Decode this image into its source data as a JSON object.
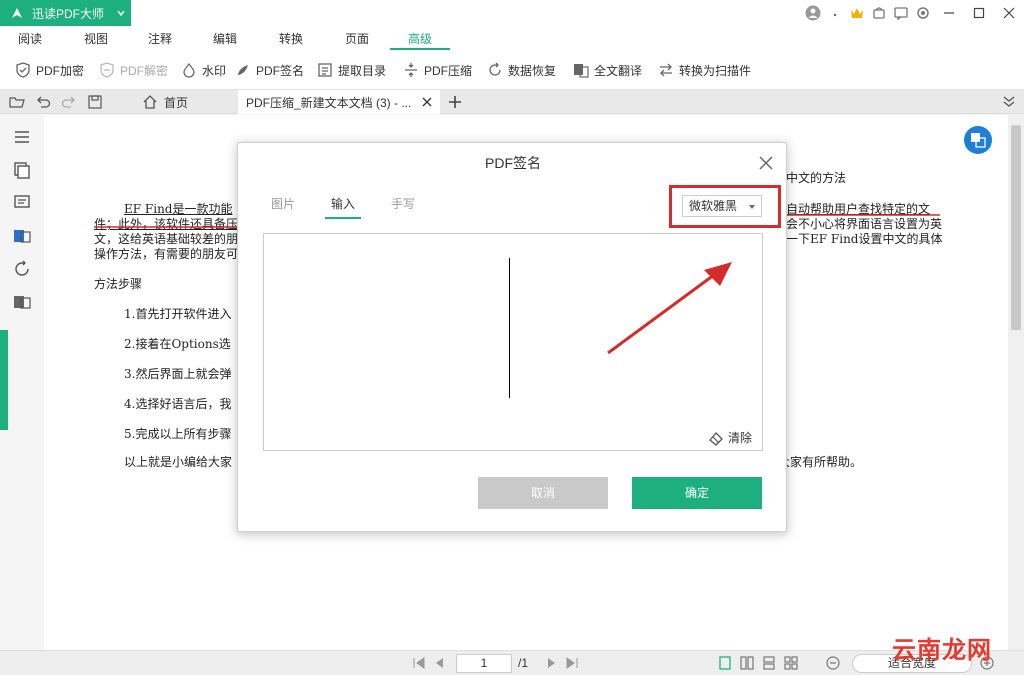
{
  "app": {
    "title": "迅读PDF大师"
  },
  "menu": {
    "tabs": [
      "阅读",
      "视图",
      "注释",
      "编辑",
      "转换",
      "页面",
      "高级"
    ],
    "active": "高级"
  },
  "ribbon": {
    "items": [
      {
        "label": "PDF加密",
        "icon": "shield-icon"
      },
      {
        "label": "PDF解密",
        "icon": "shield-off-icon",
        "disabled": true
      },
      {
        "label": "水印",
        "icon": "drop-icon"
      },
      {
        "label": "PDF签名",
        "icon": "pen-icon"
      },
      {
        "label": "提取目录",
        "icon": "extract-icon"
      },
      {
        "label": "PDF压缩",
        "icon": "compress-icon"
      },
      {
        "label": "数据恢复",
        "icon": "recover-icon"
      },
      {
        "label": "全文翻译",
        "icon": "translate-icon"
      },
      {
        "label": "转换为扫描件",
        "icon": "convert-icon"
      }
    ]
  },
  "tabs": {
    "home": "首页",
    "doc": "PDF压缩_新建文本文档 (3) - ..."
  },
  "document": {
    "lines": [
      "中文的方法",
      "EF Find是一款功能",
      "自动帮助用户查找特定的文",
      "件；此外，该软件还具备压",
      "会不小心将界面语言设置为英",
      "文，这给英语基础较差的朋",
      "一下EF Find设置中文的具体",
      "操作方法，有需要的朋友可",
      "方法步骤",
      "1.首先打开软件进入",
      "2.接着在Options选",
      "3.然后界面上就会弹",
      "4.选择好语言后，我",
      "5.完成以上所有步骤",
      "以上就是小编给大家",
      "大家有所帮助。"
    ]
  },
  "dialog": {
    "title": "PDF签名",
    "tabs": [
      "图片",
      "输入",
      "手写"
    ],
    "active_tab": "输入",
    "font": "微软雅黑",
    "clear": "清除",
    "cancel": "取消",
    "ok": "确定"
  },
  "status": {
    "page": "1",
    "total": "/1",
    "zoom": "适合宽度"
  },
  "watermark": {
    "text": "云南龙网"
  },
  "colors": {
    "accent": "#1db07e",
    "highlight": "#d52b2b",
    "cancel": "#c9c9c9"
  }
}
